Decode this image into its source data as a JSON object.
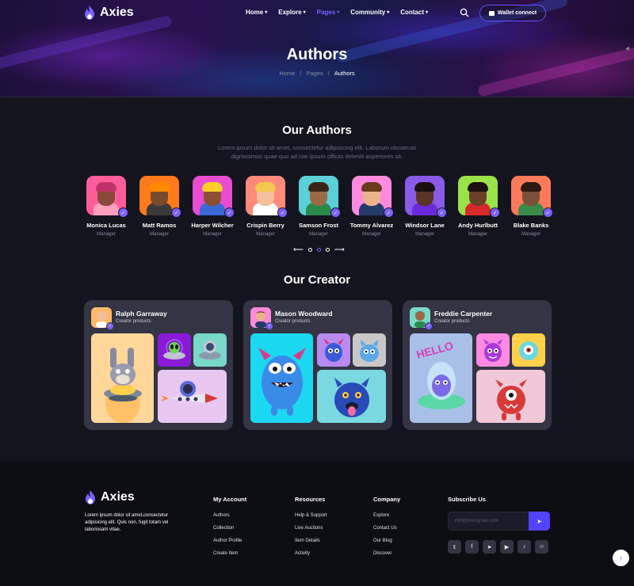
{
  "brand": {
    "name": "Axies",
    "accent": "#7b61ff",
    "button": "#5142fc"
  },
  "nav": {
    "items": [
      {
        "label": "Home",
        "active": false
      },
      {
        "label": "Explore",
        "active": false
      },
      {
        "label": "Pages",
        "active": true
      },
      {
        "label": "Community",
        "active": false
      },
      {
        "label": "Contact",
        "active": false
      }
    ],
    "wallet_label": "Wallet connect"
  },
  "hero": {
    "title": "Authors",
    "breadcrumb": [
      "Home",
      "Pages",
      "Authors"
    ]
  },
  "authors_section": {
    "title": "Our Authors",
    "description": "Lorem ipsum dolor sit amet, consectetur adipisicing elit. Laborum obcaecati dignissimos quae quo ad iste ipsum officiis deleniti asperiores sit.",
    "authors": [
      {
        "name": "Monica Lucas",
        "role": "Manager",
        "bg": "#ff5c9a",
        "skin": "#8a4a3a",
        "hair": "#c0306a",
        "shirt": "#ff9fc0"
      },
      {
        "name": "Matt Ramos",
        "role": "Manager",
        "bg": "#ff7a1a",
        "skin": "#7a4a2c",
        "hair": "#ff8a00",
        "shirt": "#3a3a3a"
      },
      {
        "name": "Harper Wilcher",
        "role": "Manager",
        "bg": "#e84cd2",
        "skin": "#8a5030",
        "hair": "#ffd02a",
        "shirt": "#3a6ad8"
      },
      {
        "name": "Crispin Berry",
        "role": "Manager",
        "bg": "#ff8a7a",
        "skin": "#f2c09a",
        "hair": "#f2c94c",
        "shirt": "#ffffff"
      },
      {
        "name": "Samson Frost",
        "role": "Manager",
        "bg": "#5ad0d8",
        "skin": "#9a6a44",
        "hair": "#3a2418",
        "shirt": "#2a8a4a"
      },
      {
        "name": "Tommy Alvarez",
        "role": "Manager",
        "bg": "#ff8ae0",
        "skin": "#e9b48a",
        "hair": "#6a3a1a",
        "shirt": "#243a6a"
      },
      {
        "name": "Windsor Lane",
        "role": "Manager",
        "bg": "#8a5ae8",
        "skin": "#5a3424",
        "hair": "#1a1010",
        "shirt": "#6a2ad8"
      },
      {
        "name": "Andy Hurlbutt",
        "role": "Manager",
        "bg": "#9ae24a",
        "skin": "#6a4028",
        "hair": "#1a1010",
        "shirt": "#d82a2a"
      },
      {
        "name": "Blake Banks",
        "role": "Manager",
        "bg": "#ff7a5a",
        "skin": "#7a5038",
        "hair": "#2a1a10",
        "shirt": "#3a8a4a"
      }
    ]
  },
  "creator_section": {
    "title": "Our Creator",
    "creators": [
      {
        "name": "Ralph Garraway",
        "subtitle": "Creator products",
        "avatar_bg": "#ffb86a",
        "tiles": [
          "#ffd79a",
          "#8a1ad8",
          "#7ad8c8",
          "#e8c8f0"
        ]
      },
      {
        "name": "Mason Woodward",
        "subtitle": "Creator products",
        "avatar_bg": "#ff8ad8",
        "tiles": [
          "#1ad8f0",
          "#b88af0",
          "#c8c8c8",
          "#7ad8e0"
        ]
      },
      {
        "name": "Freddie Carpenter",
        "subtitle": "Creator products",
        "avatar_bg": "#7ad8c8",
        "tiles": [
          "#a8c0e8",
          "#ff8ae0",
          "#ffd04a",
          "#f0c8d8"
        ]
      }
    ]
  },
  "footer": {
    "about": "Lorem ipsum dolor sit amet,consectetur adipisicing elit. Quis non, fugit totam vel laboriosam vitae.",
    "columns": [
      {
        "title": "My Account",
        "links": [
          "Authors",
          "Collection",
          "Author Profile",
          "Create Item"
        ]
      },
      {
        "title": "Resources",
        "links": [
          "Help & Support",
          "Live Auctions",
          "Item Details",
          "Activity"
        ]
      },
      {
        "title": "Company",
        "links": [
          "Explore",
          "Contact Us",
          "Our Blog",
          "Discover"
        ]
      }
    ],
    "subscribe": {
      "title": "Subscribe Us",
      "placeholder": "info@yourgmail.com"
    },
    "socials": [
      "twitter-icon",
      "facebook-icon",
      "telegram-icon",
      "youtube-icon",
      "tiktok-icon",
      "discord-icon"
    ]
  }
}
